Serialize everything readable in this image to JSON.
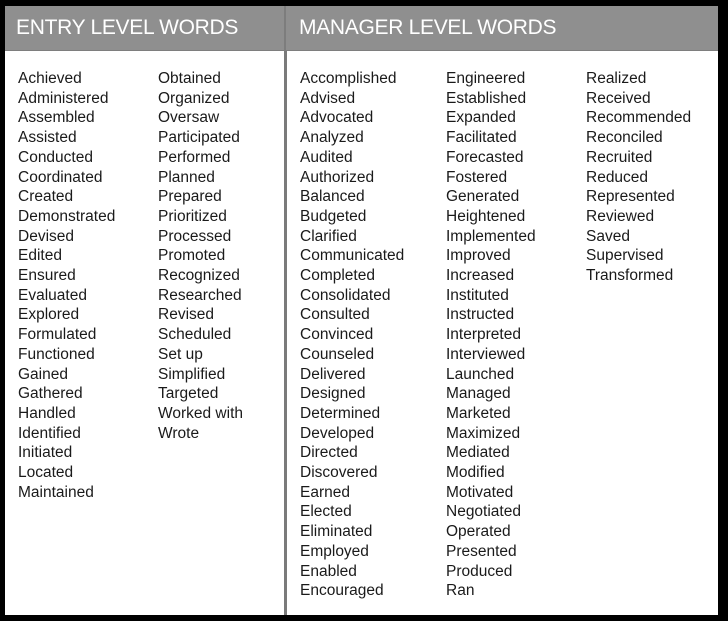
{
  "headers": {
    "entry": "ENTRY LEVEL WORDS",
    "manager": "MANAGER LEVEL WORDS"
  },
  "entry_columns": [
    [
      "Achieved",
      "Administered",
      "Assembled",
      "Assisted",
      "Conducted",
      "Coordinated",
      "Created",
      "Demonstrated",
      "Devised",
      "Edited",
      "Ensured",
      "Evaluated",
      "Explored",
      "Formulated",
      "Functioned",
      "Gained",
      "Gathered",
      "Handled",
      "Identified",
      "Initiated",
      "Located",
      "Maintained"
    ],
    [
      "Obtained",
      "Organized",
      "Oversaw",
      "Participated",
      "Performed",
      "Planned",
      "Prepared",
      "Prioritized",
      "Processed",
      "Promoted",
      "Recognized",
      "Researched",
      "Revised",
      "Scheduled",
      "Set up",
      "Simplified",
      "Targeted",
      "Worked with",
      "Wrote"
    ]
  ],
  "manager_columns": [
    [
      "Accomplished",
      "Advised",
      "Advocated",
      "Analyzed",
      "Audited",
      "Authorized",
      "Balanced",
      "Budgeted",
      "Clarified",
      "Communicated",
      "Completed",
      "Consolidated",
      "Consulted",
      "Convinced",
      "Counseled",
      "Delivered",
      "Designed",
      "Determined",
      "Developed",
      "Directed",
      "Discovered",
      "Earned",
      "Elected",
      "Eliminated",
      "Employed",
      "Enabled",
      "Encouraged"
    ],
    [
      "Engineered",
      "Established",
      "Expanded",
      "Facilitated",
      "Forecasted",
      "Fostered",
      "Generated",
      "Heightened",
      "Implemented",
      "Improved",
      "Increased",
      "Instituted",
      "Instructed",
      "Interpreted",
      "Interviewed",
      "Launched",
      "Managed",
      "Marketed",
      "Maximized",
      "Mediated",
      "Modified",
      "Motivated",
      "Negotiated",
      "Operated",
      "Presented",
      "Produced",
      "Ran"
    ],
    [
      "Realized",
      "Received",
      "Recommended",
      "Reconciled",
      "Recruited",
      "Reduced",
      "Represented",
      "Reviewed",
      "Saved",
      "Supervised",
      "Transformed"
    ]
  ]
}
